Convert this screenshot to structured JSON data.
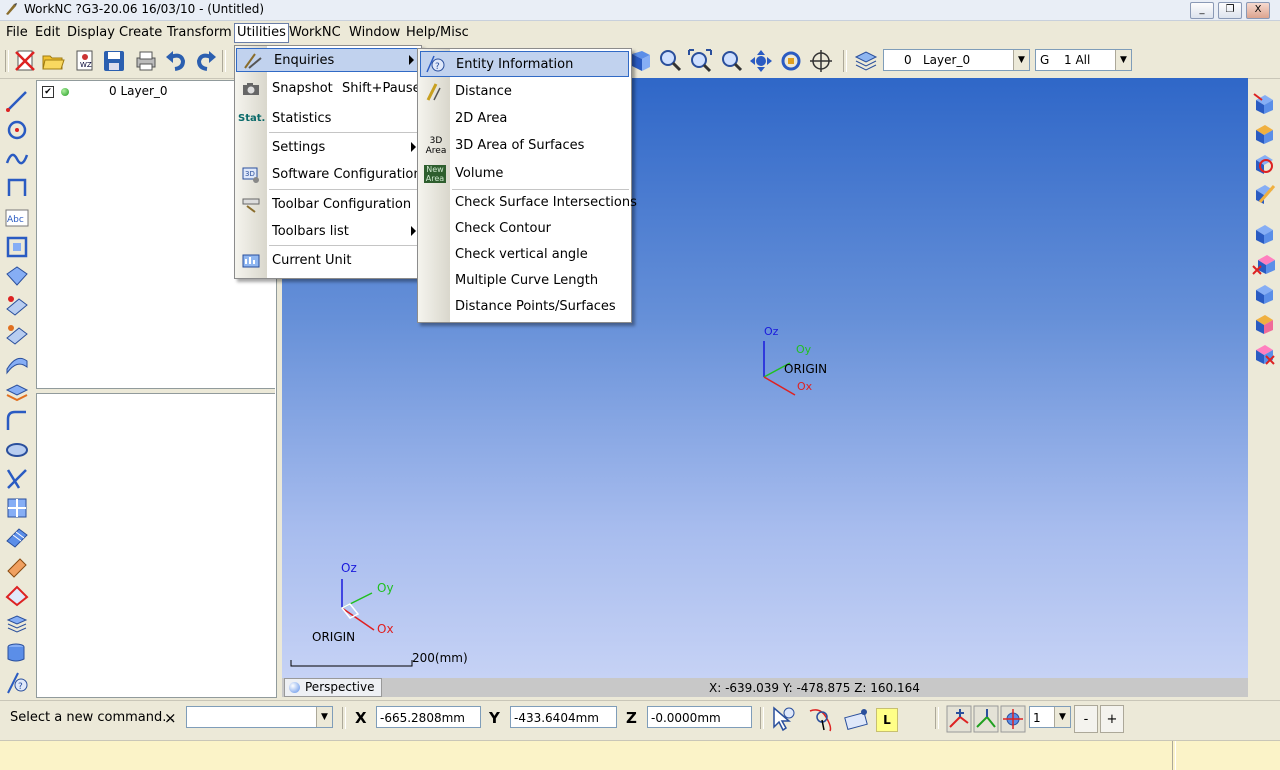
{
  "window": {
    "title": "WorkNC ?G3-20.06  16/03/10 - (Untitled)",
    "controls": {
      "minimize": "_",
      "restore": "❐",
      "close": "X"
    }
  },
  "menubar": {
    "items": [
      "File",
      "Edit",
      "Display",
      "Create",
      "Transform",
      "Utilities",
      "WorkNC",
      "Window",
      "Help/Misc"
    ],
    "active": "Utilities"
  },
  "toolbar": {
    "layer_combo": {
      "value": "0",
      "label": "Layer_0"
    },
    "group_combo": {
      "prefix": "G",
      "value": "1 All"
    }
  },
  "layer_panel": {
    "rows": [
      {
        "label": "0 Layer_0",
        "checked": true
      }
    ]
  },
  "utilities_menu": {
    "items": [
      {
        "label": "Enquiries",
        "icon": "enquiries-icon",
        "submenu": true,
        "highlighted": true
      },
      {
        "label": "Snapshot",
        "shortcut": "Shift+Pause",
        "icon": "camera-icon"
      },
      {
        "label": "Statistics",
        "icon": "statistics-icon",
        "icon_text": "Stat."
      },
      {
        "label": "Settings",
        "submenu": true
      },
      {
        "label": "Software Configuration",
        "icon": "software-config-icon"
      },
      {
        "label": "Toolbar Configuration",
        "icon": "toolbar-config-icon"
      },
      {
        "label": "Toolbars list",
        "submenu": true
      },
      {
        "label": "Current Unit",
        "icon": "current-unit-icon"
      }
    ]
  },
  "enquiries_submenu": {
    "items": [
      {
        "label": "Entity Information",
        "icon": "entity-info-icon",
        "highlighted": true
      },
      {
        "label": "Distance",
        "icon": "distance-icon"
      },
      {
        "label": "2D Area"
      },
      {
        "label": "3D Area of Surfaces",
        "icon": "3d-area-icon",
        "icon_text": "3D Area"
      },
      {
        "label": "Volume",
        "icon": "volume-icon",
        "icon_text": "New Area"
      },
      {
        "label": "Check Surface Intersections"
      },
      {
        "label": "Check Contour"
      },
      {
        "label": "Check vertical angle"
      },
      {
        "label": "Multiple Curve Length"
      },
      {
        "label": "Distance Points/Surfaces"
      }
    ]
  },
  "viewport": {
    "origin_label": "ORIGIN",
    "axes": {
      "z": "Oz",
      "y": "Oy",
      "x": "Ox"
    },
    "scale_label": "200(mm)",
    "view_tab": "Perspective",
    "cursor_coords": "X: -639.039   Y: -478.875   Z: 160.164",
    "colors": {
      "x_axis": "#e02020",
      "y_axis": "#20c020",
      "z_axis": "#1a1adc"
    }
  },
  "command_bar": {
    "prompt": "Select a new command...",
    "clear": "×",
    "x_label": "X",
    "x_value": "-665.2808mm",
    "y_label": "Y",
    "y_value": "-433.6404mm",
    "z_label": "Z",
    "z_value": "-0.0000mm",
    "mode_badge": "L",
    "stepper_value": "1",
    "minus": "-",
    "plus": "+"
  }
}
